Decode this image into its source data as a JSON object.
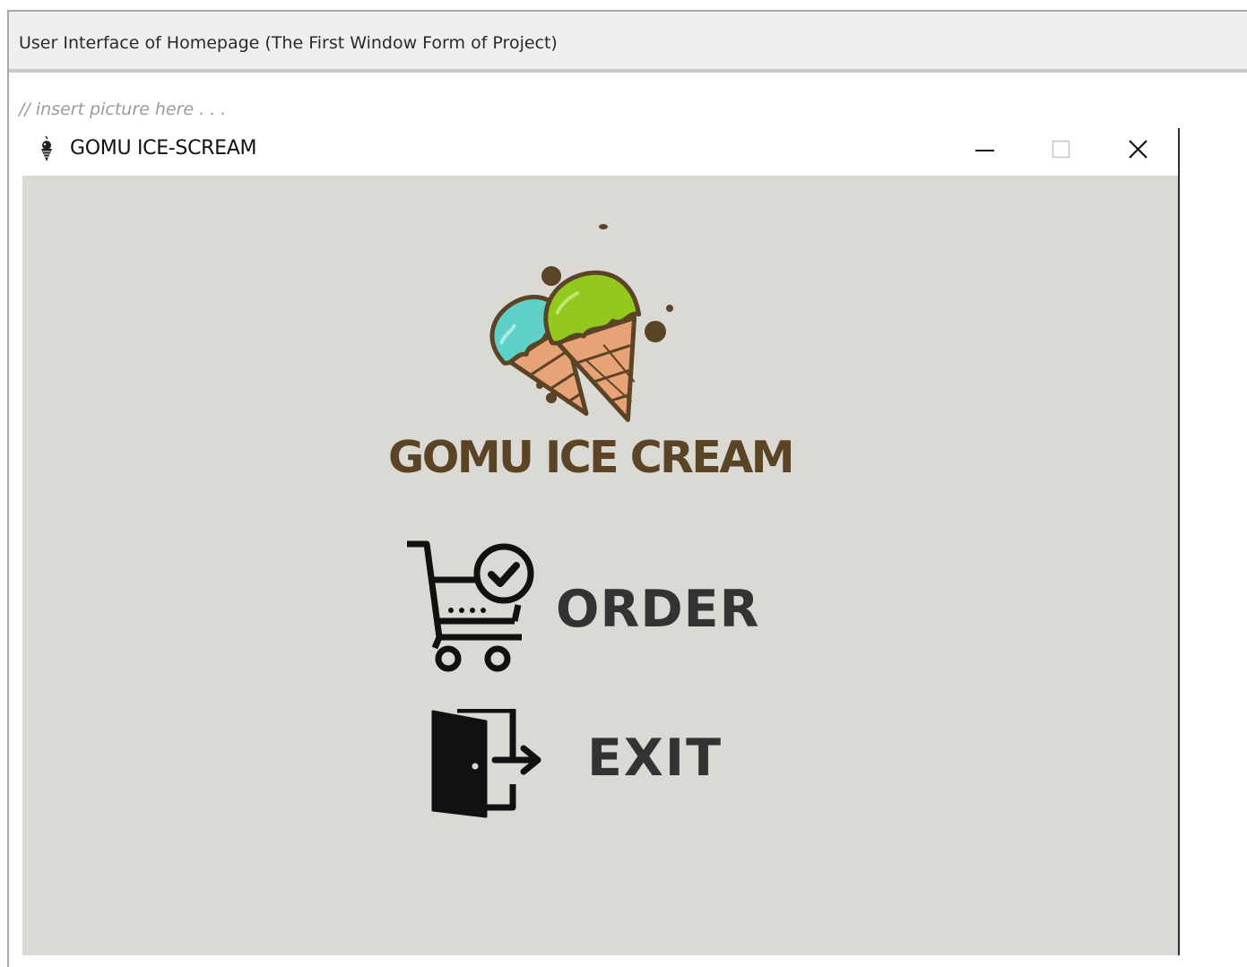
{
  "section": {
    "header": "User Interface of Homepage (The First Window Form of Project)",
    "comment": "// insert picture here . . ."
  },
  "window": {
    "title": "GOMU ICE-SCREAM",
    "app_icon": "ice-cream-cone-icon",
    "controls": {
      "minimize_icon": "minimize-icon",
      "maximize_icon": "maximize-icon",
      "close_icon": "close-icon"
    },
    "background_color": "#dad9d4"
  },
  "main": {
    "logo_icon": "ice-cream-cones-logo",
    "brand": "GOMU ICE CREAM",
    "brand_color": "#5b4325",
    "order": {
      "label": "ORDER",
      "icon": "shopping-cart-check-icon"
    },
    "exit": {
      "label": "EXIT",
      "icon": "door-exit-icon"
    },
    "button_text_color": "#333333"
  }
}
